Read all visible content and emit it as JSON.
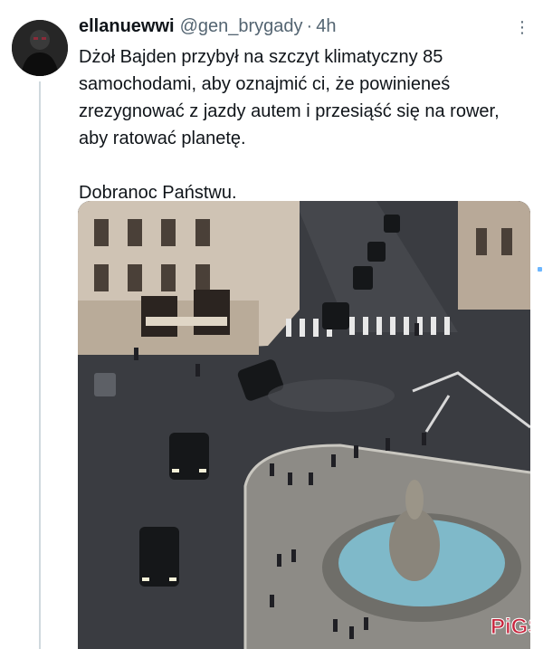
{
  "tweet": {
    "display_name": "ellanuewwi",
    "handle": "@gen_brygady",
    "separator": "·",
    "time": "4h",
    "more_icon": "more-vertical-icon",
    "text_line_1": "Dżoł Bajden przybył na szczyt klimatyczny 85 samochodami, aby oznajmić ci, że powinieneś zrezygnować z jazdy autem i przesiąść się na rower, aby ratować planetę.",
    "text_line_2": "Dobranoc Państwu."
  },
  "media": {
    "alt_subject": "aerial street view with fountain and black motorcade cars",
    "watermark_text": "PiGS",
    "colors": {
      "asphalt": "#3a3c41",
      "plaza": "#8d8b86",
      "water": "#7fb9c9",
      "building": "#cfc3b4",
      "car": "#151719"
    }
  }
}
